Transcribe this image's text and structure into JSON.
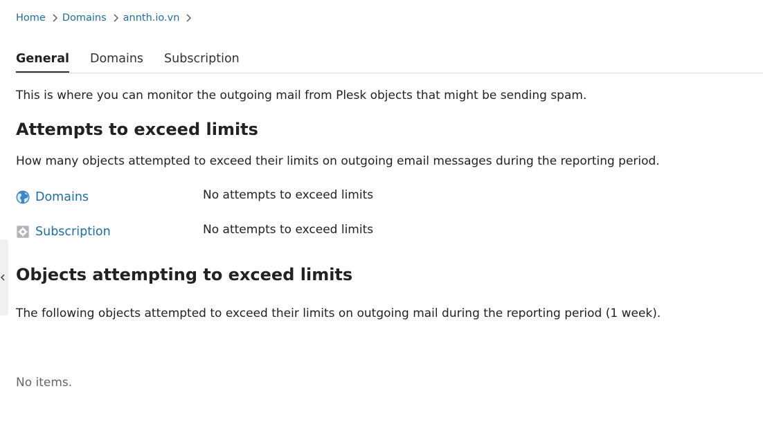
{
  "breadcrumb": {
    "items": [
      "Home",
      "Domains",
      "annth.io.vn"
    ]
  },
  "tabs": [
    {
      "label": "General",
      "active": true
    },
    {
      "label": "Domains",
      "active": false
    },
    {
      "label": "Subscription",
      "active": false
    }
  ],
  "intro_text": "This is where you can monitor the outgoing mail from Plesk objects that might be sending spam.",
  "attempts_section": {
    "title": "Attempts to exceed limits",
    "description": "How many objects attempted to exceed their limits on outgoing email messages during the reporting period.",
    "rows": [
      {
        "label": "Domains",
        "icon": "globe-icon",
        "value": "No attempts to exceed limits"
      },
      {
        "label": "Subscription",
        "icon": "subscription-gear-icon",
        "value": "No attempts to exceed limits"
      }
    ]
  },
  "objects_section": {
    "title": "Objects attempting to exceed limits",
    "description": "The following objects attempted to exceed their limits on outgoing mail during the reporting period (1 week).",
    "empty_text": "No items."
  },
  "side_panel": {
    "icon": "chevron-left-icon"
  },
  "colors": {
    "link": "#1d6fa5",
    "text": "#222222",
    "muted": "#666666",
    "border": "#d8d8d8"
  }
}
